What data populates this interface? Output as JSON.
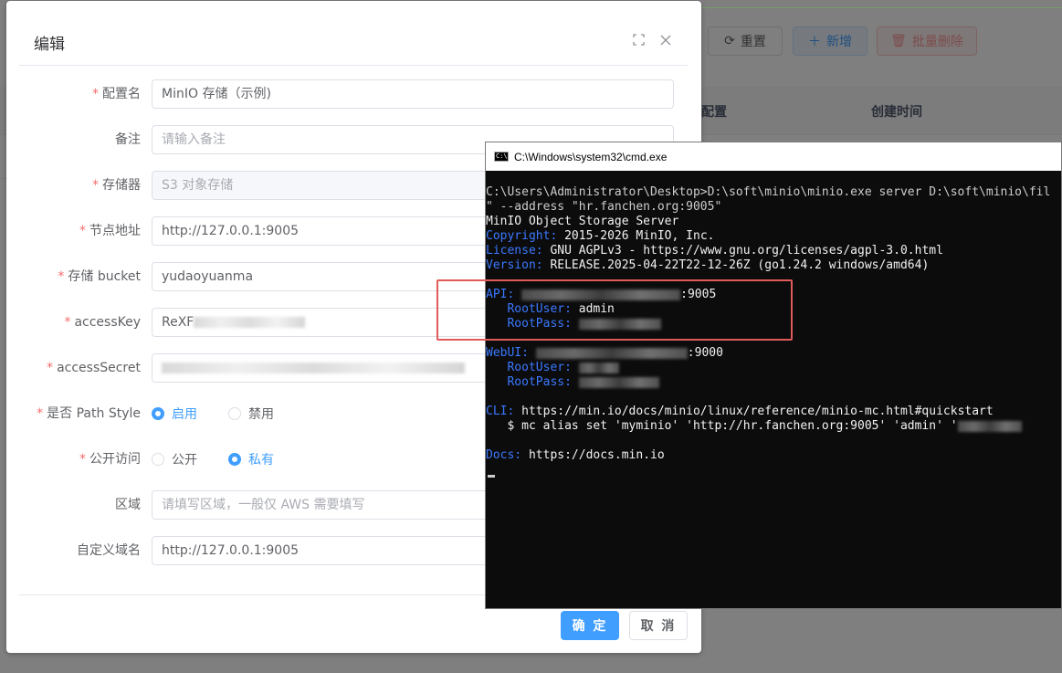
{
  "background": {
    "toolbar": {
      "reset_label": "重置",
      "add_label": "新增",
      "bulk_delete_label": "批量删除"
    },
    "table_headers": {
      "config": "配置",
      "created_time": "创建时间"
    }
  },
  "dialog": {
    "title": "编辑",
    "fields": [
      {
        "label": "配置名",
        "required": true,
        "value": "MinIO 存储（示例)",
        "type": "text"
      },
      {
        "label": "备注",
        "required": false,
        "placeholder": "请输入备注",
        "type": "text"
      },
      {
        "label": "存储器",
        "required": true,
        "value": "S3 对象存储",
        "type": "select-disabled"
      },
      {
        "label": "节点地址",
        "required": true,
        "value": "http://127.0.0.1:9005",
        "type": "text"
      },
      {
        "label": "存储 bucket",
        "required": true,
        "value": "yudaoyuanma",
        "type": "text"
      },
      {
        "label": "accessKey",
        "required": true,
        "value": "ReXF",
        "type": "text-redacted"
      },
      {
        "label": "accessSecret",
        "required": true,
        "value": "",
        "type": "text-redacted"
      },
      {
        "label": "是否 Path Style",
        "required": true,
        "type": "radio",
        "options": [
          "启用",
          "禁用"
        ],
        "selected": "启用"
      },
      {
        "label": "公开访问",
        "required": true,
        "type": "radio",
        "options": [
          "公开",
          "私有"
        ],
        "selected": "私有"
      },
      {
        "label": "区域",
        "required": false,
        "placeholder": "请填写区域，一般仅 AWS 需要填写",
        "type": "text"
      },
      {
        "label": "自定义域名",
        "required": false,
        "value": "http://127.0.0.1:9005",
        "type": "text"
      }
    ],
    "confirm_label": "确 定",
    "cancel_label": "取 消",
    "required_mark": "*"
  },
  "cmd": {
    "title": "C:\\Windows\\system32\\cmd.exe",
    "icon_text": "C:\\",
    "lines": {
      "l1": "C:\\Users\\Administrator\\Desktop>D:\\soft\\minio\\minio.exe server D:\\soft\\minio\\fil",
      "l2": "\" --address \"hr.fanchen.org:9005\"",
      "l3": "MinIO Object Storage Server",
      "copyright_key": "Copyright:",
      "copyright_val": " 2015-2026 MinIO, Inc.",
      "license_key": "License:",
      "license_val": " GNU AGPLv3 - https://www.gnu.org/licenses/agpl-3.0.html",
      "version_key": "Version:",
      "version_val": " RELEASE.2025-04-22T22-12-26Z (go1.24.2 windows/amd64)",
      "api_key": "API:",
      "api_port": ":9005",
      "rootuser_key": "   RootUser:",
      "rootuser_val": " admin",
      "rootpass_key": "   RootPass:",
      "webui_key": "WebUI:",
      "webui_port": ":9000",
      "webui_rootuser_key": "   RootUser:",
      "webui_rootpass_key": "   RootPass:",
      "cli_key": "CLI:",
      "cli_val": " https://min.io/docs/minio/linux/reference/minio-mc.html#quickstart",
      "mc_cmd": "   $ mc alias set 'myminio' 'http://hr.fanchen.org:9005' 'admin' '",
      "docs_key": "Docs:",
      "docs_val": " https://docs.min.io"
    }
  }
}
